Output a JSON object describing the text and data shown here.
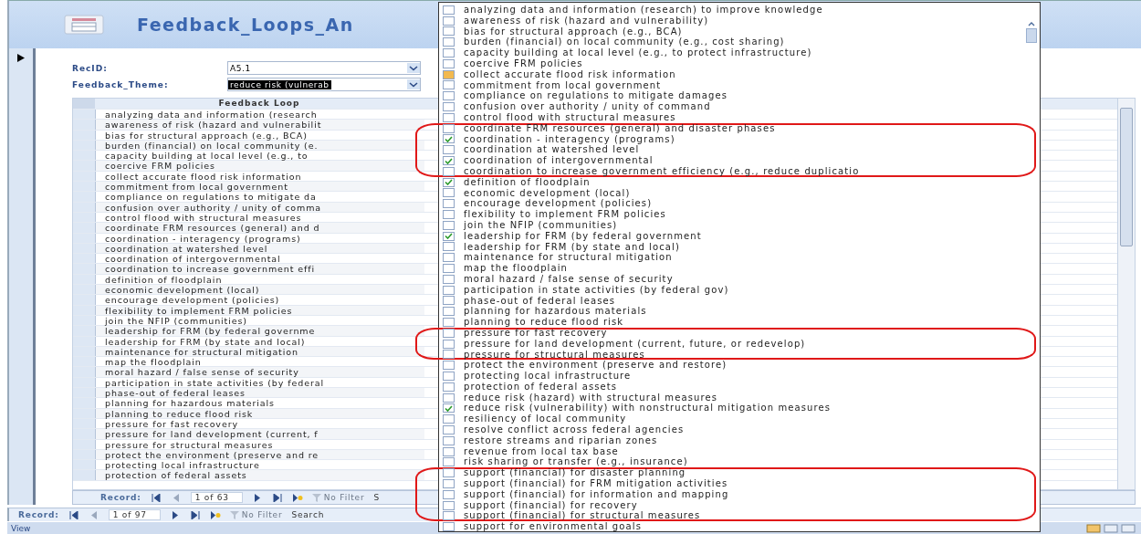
{
  "form": {
    "title": "Feedback_Loops_An",
    "fields": [
      {
        "label": "RecID:",
        "value": "A5.1",
        "selected": false
      },
      {
        "label": "Feedback_Theme:",
        "value": "reduce risk (vulnerab",
        "selected": true
      }
    ]
  },
  "datasheet": {
    "column": "Feedback Loop",
    "rows": [
      "analyzing data and information (research",
      "awareness of risk (hazard and vulnerabilit",
      "bias for structural approach (e.g., BCA)",
      "burden (financial) on local community (e.",
      "capacity building at local level (e.g., to",
      "coercive FRM policies",
      "collect accurate flood risk information",
      "commitment from local government",
      "compliance on regulations to mitigate da",
      "confusion over authority / unity of comma",
      "control flood with structural measures",
      "coordinate FRM resources (general) and d",
      "coordination - interagency (programs)",
      "coordination at watershed level",
      "coordination of intergovernmental",
      "coordination to increase government effi",
      "definition of floodplain",
      "economic development (local)",
      "encourage development (policies)",
      "flexibility to implement FRM policies",
      "join the NFIP (communities)",
      "leadership for FRM (by federal governme",
      "leadership for FRM (by state and local)",
      "maintenance for structural mitigation",
      "map the floodplain",
      "moral hazard / false sense of security",
      "participation in state activities (by federal",
      "phase-out of federal leases",
      "planning for hazardous materials",
      "planning to reduce flood risk",
      "pressure for fast recovery",
      "pressure for land development (current, f",
      "pressure for structural measures",
      "protect the environment (preserve and re",
      "protecting local infrastructure",
      "protection of federal assets"
    ],
    "navigation": {
      "label": "Record:",
      "position": "1 of 63",
      "filter": "No Filter",
      "search": "S"
    }
  },
  "navigation": {
    "label": "Record:",
    "position": "1 of 97",
    "filter": "No Filter",
    "search": "Search"
  },
  "status_bar": "View",
  "dropdown": {
    "items": [
      {
        "label": "analyzing data and information (research) to improve knowledge",
        "checked": false,
        "highlighted": false,
        "circled": false
      },
      {
        "label": "awareness of risk (hazard and vulnerability)",
        "checked": false,
        "highlighted": false,
        "circled": false
      },
      {
        "label": "bias for structural approach (e.g., BCA)",
        "checked": false,
        "highlighted": false,
        "circled": false
      },
      {
        "label": "burden (financial) on local community (e.g., cost sharing)",
        "checked": false,
        "highlighted": false,
        "circled": false
      },
      {
        "label": "capacity building at local level (e.g., to protect infrastructure)",
        "checked": false,
        "highlighted": false,
        "circled": false
      },
      {
        "label": "coercive FRM policies",
        "checked": false,
        "highlighted": false,
        "circled": false
      },
      {
        "label": "collect accurate flood risk information",
        "checked": false,
        "highlighted": true,
        "circled": false
      },
      {
        "label": "commitment from local government",
        "checked": false,
        "highlighted": false,
        "circled": false
      },
      {
        "label": "compliance on regulations to mitigate damages",
        "checked": false,
        "highlighted": false,
        "circled": false
      },
      {
        "label": "confusion over authority / unity of command",
        "checked": false,
        "highlighted": false,
        "circled": false
      },
      {
        "label": "control flood with structural measures",
        "checked": false,
        "highlighted": false,
        "circled": false
      },
      {
        "label": "coordinate FRM resources (general) and disaster phases",
        "checked": false,
        "highlighted": false,
        "circled": true
      },
      {
        "label": "coordination - interagency (programs)",
        "checked": true,
        "highlighted": false,
        "circled": true
      },
      {
        "label": "coordination at watershed level",
        "checked": false,
        "highlighted": false,
        "circled": true
      },
      {
        "label": "coordination of intergovernmental",
        "checked": true,
        "highlighted": false,
        "circled": true
      },
      {
        "label": "coordination to increase government efficiency (e.g., reduce duplicatio",
        "checked": false,
        "highlighted": false,
        "circled": true
      },
      {
        "label": "definition of floodplain",
        "checked": true,
        "highlighted": false,
        "circled": false
      },
      {
        "label": "economic development (local)",
        "checked": false,
        "highlighted": false,
        "circled": false
      },
      {
        "label": "encourage development (policies)",
        "checked": false,
        "highlighted": false,
        "circled": false
      },
      {
        "label": "flexibility to implement FRM policies",
        "checked": false,
        "highlighted": false,
        "circled": false
      },
      {
        "label": "join the NFIP (communities)",
        "checked": false,
        "highlighted": false,
        "circled": false
      },
      {
        "label": "leadership for FRM (by federal government",
        "checked": true,
        "highlighted": false,
        "circled": false
      },
      {
        "label": "leadership for FRM (by state and local)",
        "checked": false,
        "highlighted": false,
        "circled": false
      },
      {
        "label": "maintenance for structural mitigation",
        "checked": false,
        "highlighted": false,
        "circled": false
      },
      {
        "label": "map the floodplain",
        "checked": false,
        "highlighted": false,
        "circled": false
      },
      {
        "label": "moral hazard / false sense of security",
        "checked": false,
        "highlighted": false,
        "circled": false
      },
      {
        "label": "participation in state activities (by federal gov)",
        "checked": false,
        "highlighted": false,
        "circled": false
      },
      {
        "label": "phase-out of federal leases",
        "checked": false,
        "highlighted": false,
        "circled": false
      },
      {
        "label": "planning for hazardous materials",
        "checked": false,
        "highlighted": false,
        "circled": false
      },
      {
        "label": "planning to reduce flood risk",
        "checked": false,
        "highlighted": false,
        "circled": false
      },
      {
        "label": "pressure for fast recovery",
        "checked": false,
        "highlighted": false,
        "circled": true
      },
      {
        "label": "pressure for land development (current, future, or redevelop)",
        "checked": false,
        "highlighted": false,
        "circled": true
      },
      {
        "label": "pressure for structural measures",
        "checked": false,
        "highlighted": false,
        "circled": true
      },
      {
        "label": "protect the environment (preserve and restore)",
        "checked": false,
        "highlighted": false,
        "circled": false
      },
      {
        "label": "protecting local infrastructure",
        "checked": false,
        "highlighted": false,
        "circled": false
      },
      {
        "label": "protection of federal assets",
        "checked": false,
        "highlighted": false,
        "circled": false
      },
      {
        "label": "reduce risk (hazard) with structural measures",
        "checked": false,
        "highlighted": false,
        "circled": false
      },
      {
        "label": "reduce risk (vulnerability) with nonstructural mitigation measures",
        "checked": true,
        "highlighted": false,
        "circled": false
      },
      {
        "label": "resiliency of local community",
        "checked": false,
        "highlighted": false,
        "circled": false
      },
      {
        "label": "resolve conflict across federal agencies",
        "checked": false,
        "highlighted": false,
        "circled": false
      },
      {
        "label": "restore streams and riparian zones",
        "checked": false,
        "highlighted": false,
        "circled": false
      },
      {
        "label": "revenue from local tax base",
        "checked": false,
        "highlighted": false,
        "circled": false
      },
      {
        "label": "risk sharing or transfer (e.g., insurance)",
        "checked": false,
        "highlighted": false,
        "circled": false
      },
      {
        "label": "support (financial) for disaster planning",
        "checked": false,
        "highlighted": false,
        "circled": true
      },
      {
        "label": "support (financial) for FRM mitigation activities",
        "checked": false,
        "highlighted": false,
        "circled": true
      },
      {
        "label": "support (financial) for information and mapping",
        "checked": false,
        "highlighted": false,
        "circled": true
      },
      {
        "label": "support (financial) for recovery",
        "checked": false,
        "highlighted": false,
        "circled": true
      },
      {
        "label": "support (financial) for structural measures",
        "checked": false,
        "highlighted": false,
        "circled": true
      },
      {
        "label": "support for environmental goals",
        "checked": false,
        "highlighted": false,
        "circled": false
      }
    ]
  }
}
